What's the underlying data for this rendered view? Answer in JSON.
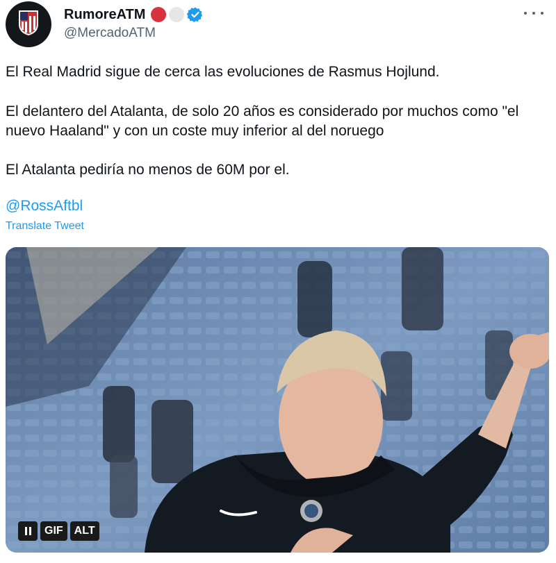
{
  "header": {
    "display_name": "RumoreATM",
    "handle": "@MercadoATM",
    "colors": {
      "flag_red": "#d6333f",
      "flag_white": "#e6e6e6",
      "verified": "#1d9bf0"
    }
  },
  "tweet": {
    "paragraphs": [
      "El Real Madrid sigue de cerca las evoluciones de Rasmus Hojlund.",
      "El delantero del Atalanta, de solo 20 años es considerado por muchos como \"el nuevo Haaland\" y con un coste muy inferior al del noruego",
      "El Atalanta pediría no menos de 60M por el."
    ],
    "mention": "@RossAftbl",
    "translate_label": "Translate Tweet"
  },
  "media": {
    "gif_label": "GIF",
    "alt_label": "ALT"
  },
  "icons": [
    "avatar-crest-icon",
    "verified-icon",
    "more-icon",
    "pause-icon"
  ]
}
